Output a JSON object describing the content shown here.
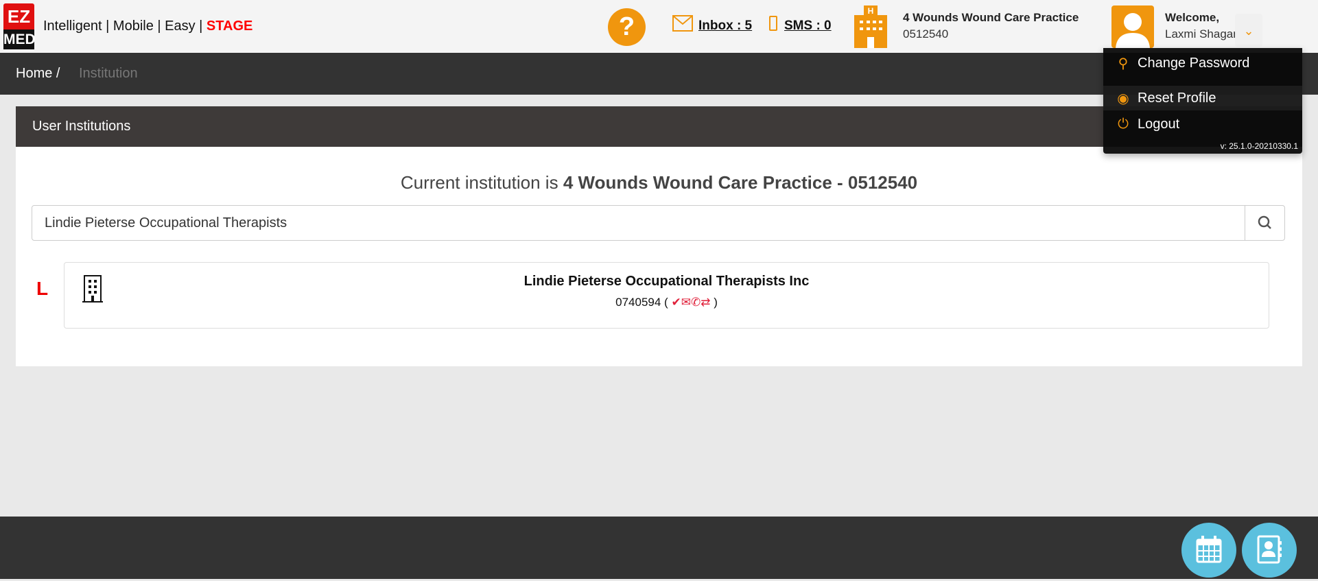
{
  "header": {
    "logo": {
      "top": "EZ",
      "bottom": "MED"
    },
    "tagline": "Intelligent | Mobile | Easy | ",
    "stage": "STAGE",
    "help_icon": "question-circle",
    "inbox": "Inbox : 5",
    "sms": "SMS : 0",
    "practice_name": "4 Wounds Wound Care Practice",
    "practice_code": "0512540",
    "welcome": "Welcome,",
    "user_name": "Laxmi Shaganti",
    "accent": "#f0960e"
  },
  "user_menu": {
    "items": [
      {
        "label": "Change Password",
        "icon": "key"
      },
      {
        "label": "Reset Profile",
        "icon": "user-circle"
      },
      {
        "label": "Logout",
        "icon": "power"
      }
    ],
    "version": "v: 25.1.0-20210330.1"
  },
  "breadcrumb": {
    "home": "Home /",
    "current": "Institution"
  },
  "panel": {
    "title": "User Institutions",
    "current_prefix": "Current institution is ",
    "current_name": "4 Wounds Wound Care Practice - 0512540",
    "search_value": "Lindie Pieterse Occupational Therapists",
    "group_letter": "L",
    "results": [
      {
        "name": "Lindie Pieterse Occupational Therapists Inc",
        "code": "0740594 (",
        "icons": [
          "check-circle",
          "envelope",
          "phone",
          "exchange"
        ],
        "close": ")"
      }
    ]
  },
  "footer": {
    "buttons": [
      "calendar",
      "contacts"
    ],
    "button_color": "#5bc0de"
  }
}
